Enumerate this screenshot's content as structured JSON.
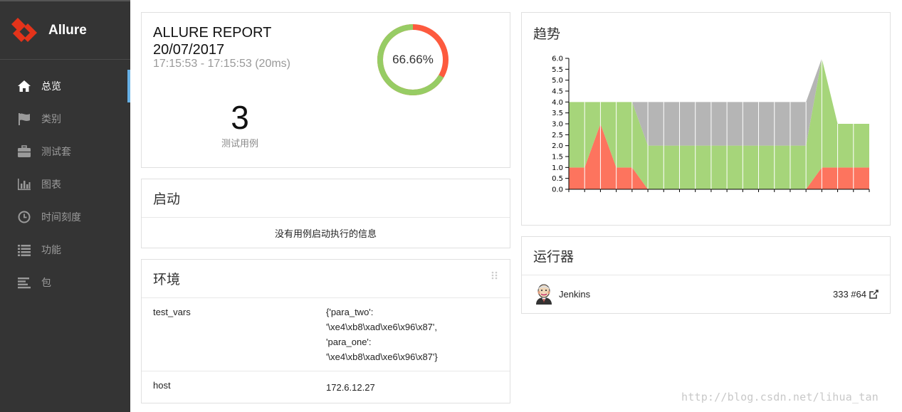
{
  "brand": {
    "name": "Allure",
    "accent": "#e4331a"
  },
  "sidebar": {
    "items": [
      {
        "label": "总览",
        "icon": "home-icon",
        "active": true
      },
      {
        "label": "类别",
        "icon": "flag-icon",
        "active": false
      },
      {
        "label": "测试套",
        "icon": "briefcase-icon",
        "active": false
      },
      {
        "label": "图表",
        "icon": "bar-chart-icon",
        "active": false
      },
      {
        "label": "时间刻度",
        "icon": "clock-icon",
        "active": false
      },
      {
        "label": "功能",
        "icon": "list-icon",
        "active": false
      },
      {
        "label": "包",
        "icon": "align-left-icon",
        "active": false
      }
    ]
  },
  "summary": {
    "report_name": "ALLURE REPORT",
    "date": "20/07/2017",
    "time_range": "17:15:53 - 17:15:53 (20ms)",
    "pass_percent_label": "66.66%",
    "pass_fraction": 0.6666,
    "test_count": "3",
    "test_count_label": "测试用例",
    "colors": {
      "passed": "#97cc64",
      "failed": "#fd5a3e"
    }
  },
  "launch": {
    "title": "启动",
    "empty_message": "没有用例启动执行的信息"
  },
  "environment": {
    "title": "环境",
    "rows": [
      {
        "key": "test_vars",
        "value": "{'para_two':\n'\\xe4\\xb8\\xad\\xe6\\x96\\x87',\n'para_one':\n'\\xe4\\xb8\\xad\\xe6\\x96\\x87'}"
      },
      {
        "key": "host",
        "value": "172.6.12.27"
      }
    ]
  },
  "trend": {
    "title": "趋势"
  },
  "executors": {
    "title": "运行器",
    "items": [
      {
        "name": "Jenkins",
        "build": "333 #64",
        "icon": "jenkins-icon"
      }
    ]
  },
  "watermark": "http://blog.csdn.net/lihua_tan",
  "chart_data": {
    "type": "area",
    "title": "趋势",
    "ylim": [
      0,
      6
    ],
    "yticks": [
      "0.0",
      "0.5",
      "1.0",
      "1.5",
      "2.0",
      "2.5",
      "3.0",
      "3.5",
      "4.0",
      "4.5",
      "5.0",
      "5.5",
      "6.0"
    ],
    "x": [
      0,
      1,
      2,
      3,
      4,
      5,
      6,
      7,
      8,
      9,
      10,
      11,
      12,
      13,
      14,
      15,
      16,
      17,
      18,
      19
    ],
    "series": [
      {
        "values": [
          1,
          1,
          3,
          1,
          1,
          0,
          0,
          0,
          0,
          0,
          0,
          0,
          0,
          0,
          0,
          0,
          1,
          1,
          1,
          1
        ],
        "color": "#fd745e"
      },
      {
        "values": [
          3,
          3,
          1,
          3,
          3,
          2,
          2,
          2,
          2,
          2,
          2,
          2,
          2,
          2,
          2,
          2,
          5,
          2,
          2,
          2
        ],
        "color": "#a6d57a"
      },
      {
        "values": [
          0,
          0,
          0,
          0,
          0,
          2,
          2,
          2,
          2,
          2,
          2,
          2,
          2,
          2,
          2,
          2,
          0,
          0,
          0,
          0
        ],
        "color": "#b5b5b5"
      }
    ],
    "grid": false
  }
}
